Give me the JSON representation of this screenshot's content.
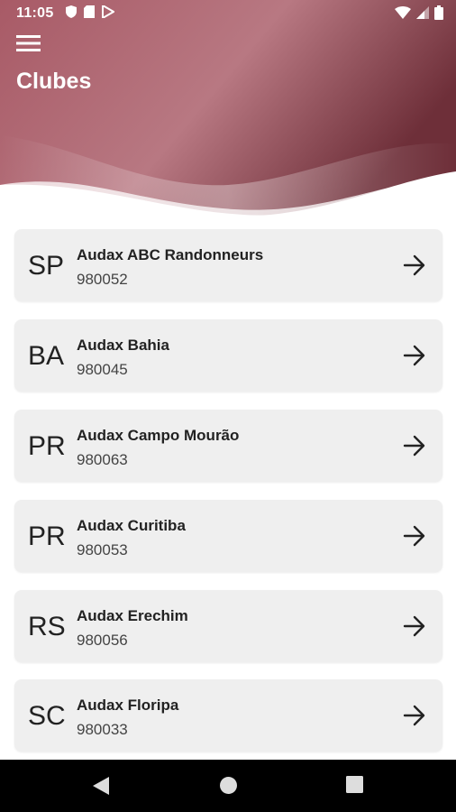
{
  "status_bar": {
    "time": "11:05"
  },
  "header": {
    "title": "Clubes",
    "colors": {
      "gradient_dark": "#7a3a44",
      "gradient_light": "#c6949a"
    }
  },
  "clubs": [
    {
      "state": "SP",
      "name": "Audax ABC Randonneurs",
      "code": "980052"
    },
    {
      "state": "BA",
      "name": "Audax Bahia",
      "code": "980045"
    },
    {
      "state": "PR",
      "name": "Audax Campo Mourão",
      "code": "980063"
    },
    {
      "state": "PR",
      "name": "Audax Curitiba",
      "code": "980053"
    },
    {
      "state": "RS",
      "name": "Audax Erechim",
      "code": "980056"
    },
    {
      "state": "SC",
      "name": "Audax Floripa",
      "code": "980033"
    }
  ],
  "icons": {
    "menu": "hamburger-icon",
    "row_action": "arrow-right-icon",
    "nav": [
      "back-icon",
      "home-icon",
      "recents-icon"
    ]
  }
}
